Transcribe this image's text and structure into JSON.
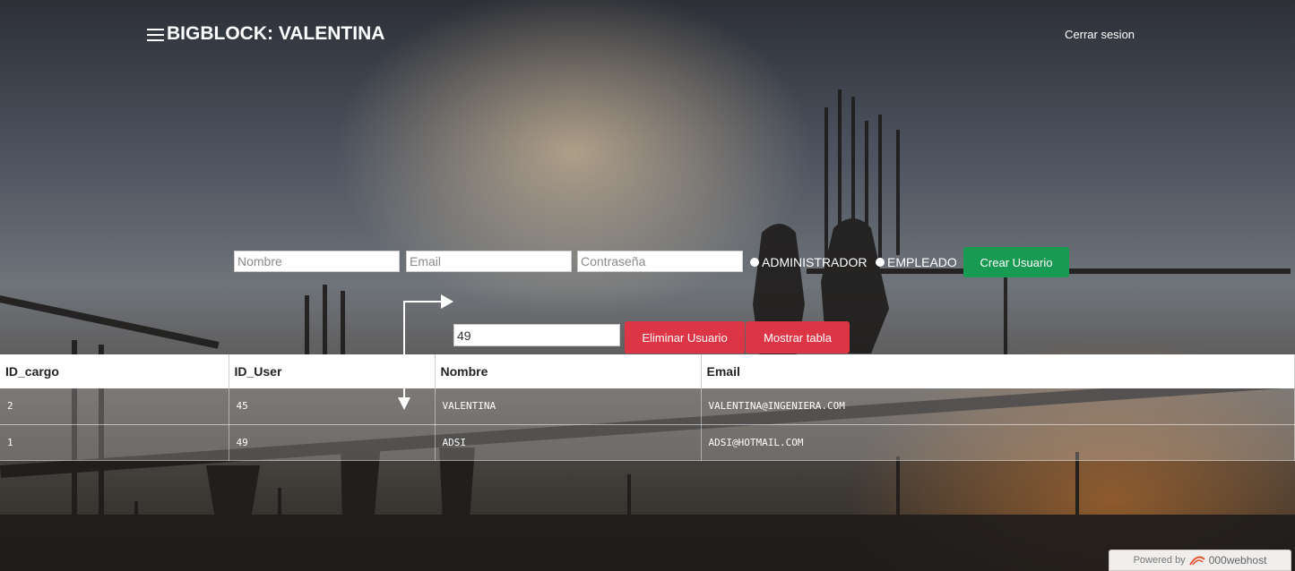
{
  "header": {
    "brand": "BIGBLOCK: VALENTINA",
    "logout_label": "Cerrar sesion"
  },
  "create_form": {
    "name_placeholder": "Nombre",
    "email_placeholder": "Email",
    "password_placeholder": "Contraseña",
    "role_admin_label": "ADMINISTRADOR",
    "role_employee_label": "EMPLEADO",
    "create_button": "Crear Usuario"
  },
  "delete_form": {
    "id_value": "49",
    "delete_button": "Eliminar Usuario",
    "show_table_button": "Mostrar tabla"
  },
  "table": {
    "headers": [
      "ID_cargo",
      "ID_User",
      "Nombre",
      "Email"
    ],
    "rows": [
      [
        "2",
        "45",
        "VALENTINA",
        "VALENTINA@INGENIERA.COM"
      ],
      [
        "1",
        "49",
        "ADSI",
        "ADSI@HOTMAIL.COM"
      ]
    ]
  },
  "footer_badge": {
    "powered_by": "Powered by",
    "host": "000webhost"
  },
  "colors": {
    "create_button": "#199a52",
    "danger_button": "#dc3545"
  }
}
